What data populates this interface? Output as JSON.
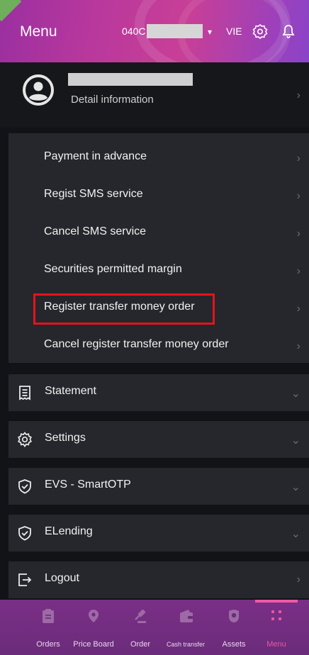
{
  "header": {
    "title": "Menu",
    "account_prefix": "040C",
    "language": "VIE"
  },
  "profile": {
    "detail_label": "Detail information"
  },
  "submenu": {
    "items": [
      {
        "label": "Payment in advance"
      },
      {
        "label": "Regist SMS service"
      },
      {
        "label": "Cancel SMS service"
      },
      {
        "label": "Securities permitted margin"
      },
      {
        "label": "Register transfer money order"
      },
      {
        "label": "Cancel register transfer money order"
      }
    ]
  },
  "sections": {
    "statement": "Statement",
    "settings": "Settings",
    "evs": "EVS - SmartOTP",
    "elending": "ELending",
    "logout": "Logout"
  },
  "bottom_nav": {
    "items": [
      {
        "label": "Orders"
      },
      {
        "label": "Price Board"
      },
      {
        "label": "Order"
      },
      {
        "label": "Cash transfer"
      },
      {
        "label": "Assets"
      },
      {
        "label": "Menu"
      }
    ],
    "active": "Menu"
  },
  "colors": {
    "header_gradient_start": "#9a2fa0",
    "header_gradient_end": "#8a44c8",
    "background": "#121316",
    "card": "#25272c",
    "highlight_border": "#e4141b",
    "nav_background": "#7a2f86",
    "nav_active": "#e65aa0"
  },
  "icons": {
    "header": [
      "caret-down-icon",
      "settings-badge-icon",
      "bell-icon"
    ],
    "profile": "user-avatar-icon",
    "sections": [
      "receipt-icon",
      "gear-icon",
      "shield-check-icon",
      "shield-check-icon",
      "logout-icon"
    ],
    "nav": [
      "clipboard-icon",
      "price-tag-icon",
      "gavel-icon",
      "wallet-icon",
      "piggy-icon",
      "grid-icon"
    ]
  }
}
